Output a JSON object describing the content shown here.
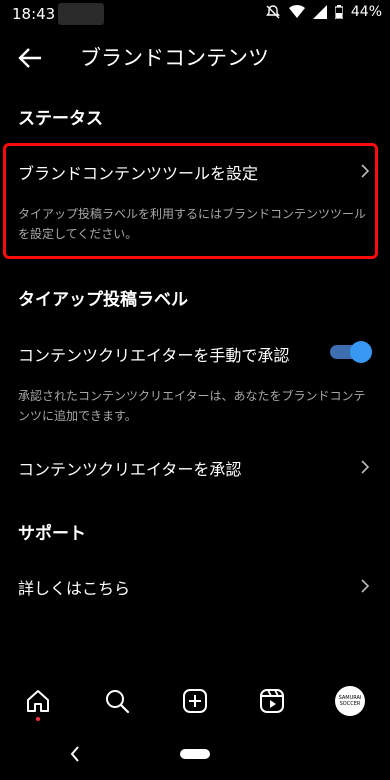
{
  "status_bar": {
    "time": "18:43",
    "battery": "44%"
  },
  "header": {
    "title": "ブランドコンテンツ"
  },
  "status_section": {
    "title": "ステータス",
    "tool_item": {
      "label": "ブランドコンテンツツールを設定",
      "description": "タイアップ投稿ラベルを利用するにはブランドコンテンツツールを設定してください。"
    }
  },
  "tieup_section": {
    "title": "タイアップ投稿ラベル",
    "manual_approve": {
      "label": "コンテンツクリエイターを手動で承認",
      "enabled": true
    },
    "manual_description": "承認されたコンテンツクリエイターは、あなたをブランドコンテンツに追加できます。",
    "approve_item": {
      "label": "コンテンツクリエイターを承認"
    }
  },
  "support_section": {
    "title": "サポート",
    "learn_more": {
      "label": "詳しくはこちら"
    }
  },
  "bottom_nav": {
    "avatar_text_1": "SAMURAI",
    "avatar_text_2": "SOCCER"
  },
  "colors": {
    "background": "#000000",
    "toggle_on": "#3897f0",
    "highlight_border": "#ff0a0a"
  },
  "icons": [
    "back-arrow-icon",
    "chevron-right-icon",
    "home-icon",
    "search-icon",
    "create-icon",
    "reels-icon"
  ]
}
